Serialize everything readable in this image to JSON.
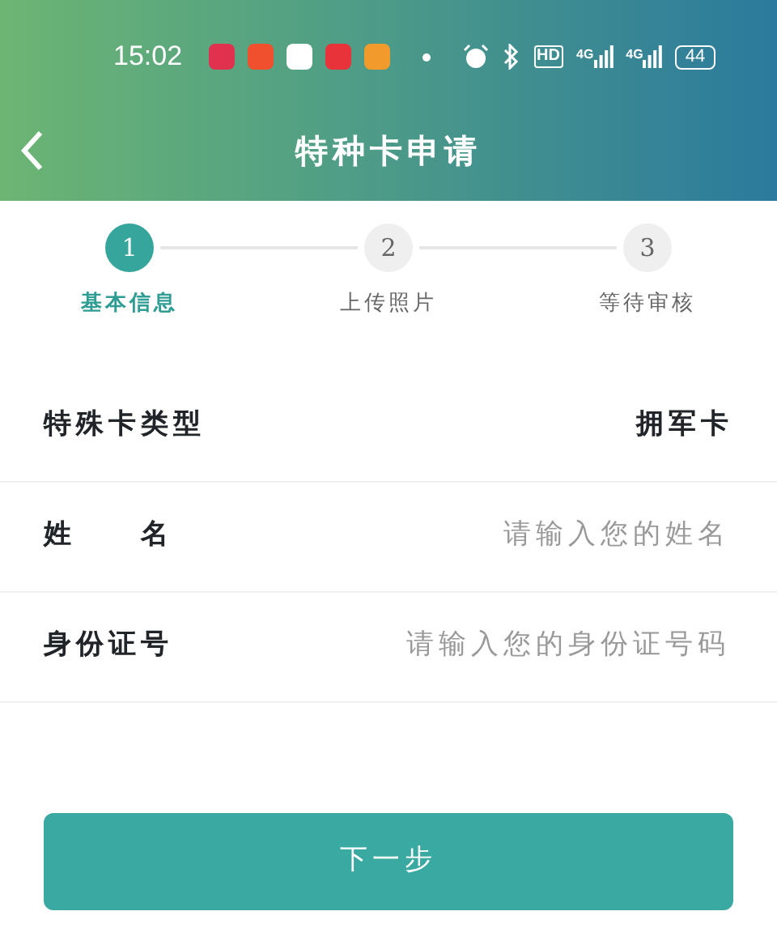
{
  "status_bar": {
    "time": "15:02",
    "hd": "HD",
    "networks": [
      "4G",
      "4G"
    ],
    "battery": "44"
  },
  "header": {
    "title": "特种卡申请"
  },
  "steps": [
    {
      "number": "1",
      "label": "基本信息",
      "selected": true
    },
    {
      "number": "2",
      "label": "上传照片",
      "selected": false
    },
    {
      "number": "3",
      "label": "等待审核",
      "selected": false
    }
  ],
  "fields": [
    {
      "label": "特殊卡类型",
      "value": "拥军卡"
    },
    {
      "label": "姓　　名",
      "placeholder": "请输入您的姓名"
    },
    {
      "label": "身份证号",
      "placeholder": "请输入您的身份证号码"
    }
  ],
  "next_button": "下一步"
}
